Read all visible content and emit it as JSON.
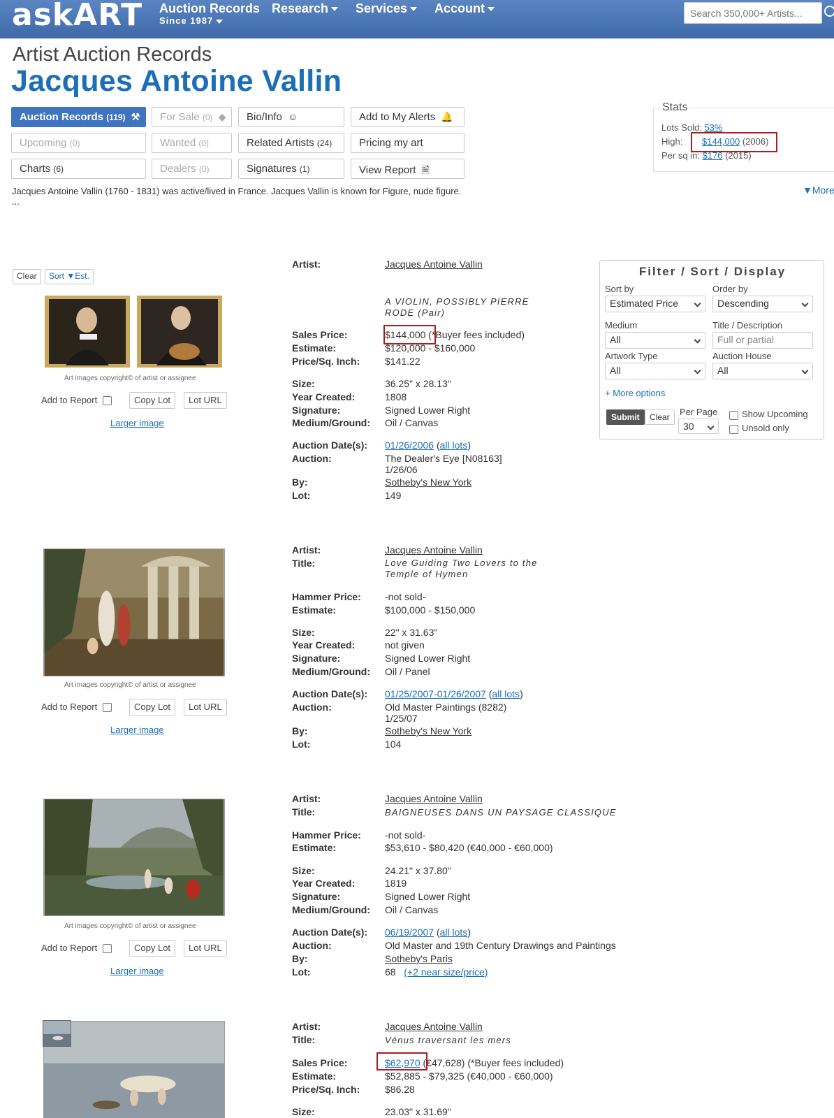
{
  "header": {
    "logo": "askART",
    "nav": [
      {
        "label": "Auction Records",
        "sub": "Since 1987"
      },
      {
        "label": "Research"
      },
      {
        "label": "Services"
      },
      {
        "label": "Account"
      }
    ],
    "search_placeholder": "Search 350,000+ Artists..."
  },
  "page": {
    "kicker": "Artist Auction Records",
    "artist": "Jacques Antoine Vallin",
    "bio": "Jacques Antoine Vallin (1760 - 1831) was active/lived in France.  Jacques Vallin is known for Figure, nude figure.",
    "bio_more": "...",
    "more_link": "▼More"
  },
  "buttons": {
    "auction_records": "Auction Records",
    "auction_records_count": "(119)",
    "for_sale": "For Sale",
    "for_sale_count": "(0)",
    "bio_info": "Bio/Info",
    "add_alerts": "Add to My Alerts",
    "upcoming": "Upcoming",
    "upcoming_count": "(0)",
    "wanted": "Wanted",
    "wanted_count": "(0)",
    "related": "Related Artists",
    "related_count": "(24)",
    "pricing": "Pricing my art",
    "charts": "Charts",
    "charts_count": "(6)",
    "dealers": "Dealers",
    "dealers_count": "(0)",
    "signatures": "Signatures",
    "signatures_count": "(1)",
    "view_report": "View Report"
  },
  "stats": {
    "legend": "Stats",
    "lots_sold_label": "Lots Sold: ",
    "lots_sold": "53%",
    "high_label": "High:",
    "high": "$144,000",
    "high_year": "(2006)",
    "persq_label": "Per sq in:",
    "persq": "$176",
    "persq_year": "(2015)"
  },
  "list_controls": {
    "clear": "Clear",
    "sort": "Sort",
    "sort_val": "Est."
  },
  "filter": {
    "title": "Filter / Sort / Display",
    "sort_by_label": "Sort by",
    "sort_by": "Estimated Price",
    "order_by_label": "Order by",
    "order_by": "Descending",
    "medium_label": "Medium",
    "medium": "All",
    "title_label": "Title / Description",
    "title_placeholder": "Full or partial",
    "artwork_type_label": "Artwork Type",
    "artwork_type": "All",
    "auction_house_label": "Auction House",
    "auction_house": "All",
    "more_options": "+ More options",
    "submit": "Submit",
    "clear": "Clear",
    "per_page_label": "Per Page",
    "per_page": "30",
    "show_upcoming": "Show Upcoming",
    "unsold_only": "Unsold only"
  },
  "common": {
    "copyright": "Art images copyright© of artist or assignee",
    "add_to_report": "Add to Report",
    "copy_lot": "Copy Lot",
    "lot_url": "Lot URL",
    "larger_image": "Larger image",
    "all_lots": "all lots"
  },
  "labels": {
    "artist": "Artist:",
    "title": "Title:",
    "sales_price": "Sales Price:",
    "hammer_price": "Hammer Price:",
    "estimate": "Estimate:",
    "price_sq": "Price/Sq. Inch:",
    "size": "Size:",
    "year": "Year Created:",
    "signature": "Signature:",
    "medium": "Medium/Ground:",
    "auction_date": "Auction Date(s):",
    "auction": "Auction:",
    "by": "By:",
    "lot": "Lot:"
  },
  "lots": [
    {
      "artist": "Jacques Antoine Vallin",
      "title": "A VIOLIN, POSSIBLY PIERRE RODE (Pair)",
      "price": "$144,000",
      "price_note": "(*Buyer fees included)",
      "estimate": "$120,000 - $160,000",
      "price_sq": "$141.22",
      "size": "36.25\" x 28.13\"",
      "year": "1808",
      "signature": "Signed Lower Right",
      "medium": "Oil / Canvas",
      "date": "01/26/2006",
      "auction": "The Dealer's Eye [N08163]",
      "auction2": "1/26/06",
      "by": "Sotheby's New York",
      "lot": "149"
    },
    {
      "artist": "Jacques Antoine Vallin",
      "title": "Love Guiding Two Lovers to the Temple of Hymen",
      "price": "-not sold-",
      "estimate": "$100,000 - $150,000",
      "size": "22\" x 31.63\"",
      "year": "not given",
      "signature": "Signed Lower Right",
      "medium": "Oil / Panel",
      "date": "01/25/2007-01/26/2007",
      "auction": "Old Master Paintings (8282)",
      "auction2": "1/25/07",
      "by": "Sotheby's New York",
      "lot": "104"
    },
    {
      "artist": "Jacques Antoine Vallin",
      "title": "BAIGNEUSES DANS UN PAYSAGE CLASSIQUE",
      "price": "-not sold-",
      "estimate": "$53,610 - $80,420  (€40,000 - €60,000)",
      "size": "24.21\" x 37.80\"",
      "year": "1819",
      "signature": "Signed Lower Right",
      "medium": "Oil / Canvas",
      "date": "06/19/2007",
      "auction": "Old Master and 19th Century Drawings and Paintings",
      "by": "Sotheby's Paris",
      "lot": "68",
      "lot_extra": "(+2 near size/price)"
    },
    {
      "artist": "Jacques Antoine Vallin",
      "title": "Vénus traversant les mers",
      "price": "$62,970",
      "price_eur": "(€47,628)",
      "price_note": "(*Buyer fees included)",
      "estimate": "$52,885 - $79,325  (€40,000 - €60,000)",
      "price_sq": "$86.28",
      "size": "23.03\" x 31.69\""
    }
  ]
}
